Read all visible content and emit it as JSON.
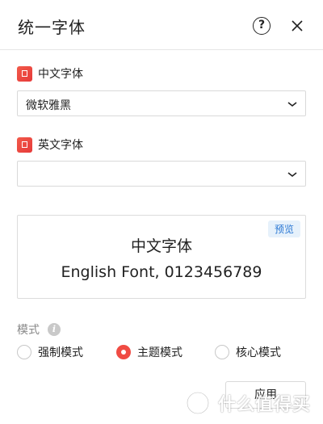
{
  "dialog": {
    "title": "统一字体",
    "help_glyph": "?",
    "help_icon": "question-circle-icon",
    "close_icon": "close-x-icon"
  },
  "chinese_font": {
    "label": "中文字体",
    "icon": "font-file-icon",
    "icon_color": "#ee4a3f",
    "selected": "微软雅黑"
  },
  "english_font": {
    "label": "英文字体",
    "icon": "font-file-icon",
    "icon_color": "#ee4a3f",
    "selected": ""
  },
  "preview": {
    "badge": "预览",
    "chinese_sample": "中文字体",
    "english_sample": "English Font, 0123456789"
  },
  "mode": {
    "label": "模式",
    "info_glyph": "i",
    "options": [
      {
        "label": "强制模式",
        "checked": false
      },
      {
        "label": "主题模式",
        "checked": true
      },
      {
        "label": "核心模式",
        "checked": false
      }
    ],
    "accent_color": "#f04b43"
  },
  "footer": {
    "apply_label": "应用"
  },
  "watermark": {
    "text": "什么值得买"
  }
}
